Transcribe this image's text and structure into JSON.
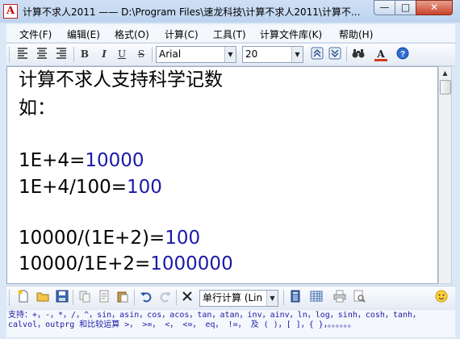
{
  "window": {
    "title": "计算不求人2011 —— D:\\Program Files\\速龙科技\\计算不求人2011\\计算不...",
    "app_icon_glyph": "A",
    "buttons": {
      "minimize": "—",
      "maximize": "□",
      "close": "✕"
    }
  },
  "menu": {
    "items": [
      "文件(F)",
      "编辑(E)",
      "格式(O)",
      "计算(C)",
      "工具(T)",
      "计算文件库(K)",
      "帮助(H)"
    ]
  },
  "format_toolbar": {
    "bold": "B",
    "italic": "I",
    "underline": "U",
    "strike": "S",
    "font_name": "Arial",
    "font_size": "20",
    "text_color": "A",
    "accent_color": "#d23a1a"
  },
  "editor": {
    "lines": [
      {
        "expr": "计算不求人支持科学记数",
        "result": ""
      },
      {
        "expr": "如：",
        "result": ""
      },
      {
        "expr": "",
        "result": ""
      },
      {
        "expr": "1E+4=",
        "result": "10000"
      },
      {
        "expr": "1E+4/100=",
        "result": "100"
      },
      {
        "expr": "",
        "result": ""
      },
      {
        "expr": "10000/(1E+2)=",
        "result": "100"
      },
      {
        "expr": "10000/1E+2=",
        "result": "1000000"
      }
    ],
    "result_color": "#1a1aa8"
  },
  "bottom_toolbar": {
    "calc_mode": "单行计算 (Lin"
  },
  "status": {
    "help_text": "支持：+，-，*，/，^，sin，asin，cos，acos，tan，atan，inv，ainv，ln，log，sinh，cosh，tanh，calvol，outprg 和比较运算 >， >=， <， <=， eq， !=， 及 ( )，[ ]，{ }，。。。。。。"
  }
}
